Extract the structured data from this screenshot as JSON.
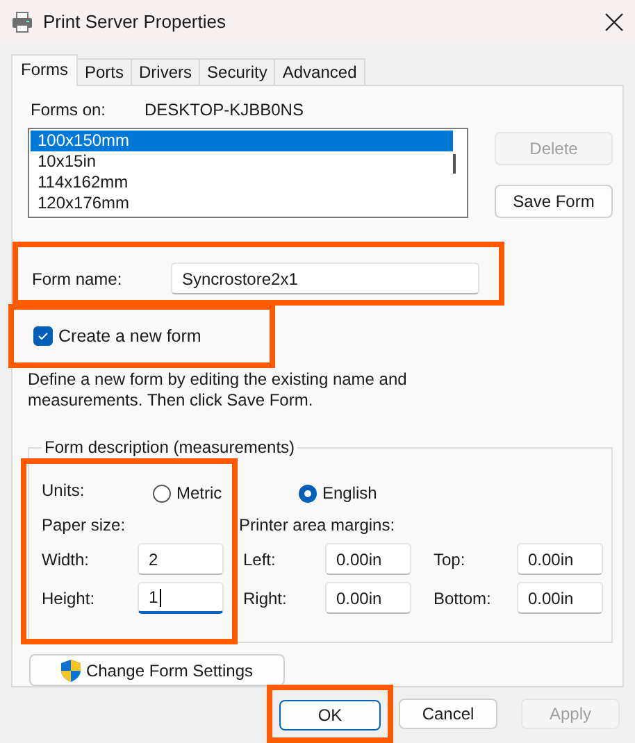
{
  "window": {
    "title": "Print Server Properties"
  },
  "tabs": [
    {
      "label": "Forms",
      "selected": true
    },
    {
      "label": "Ports",
      "selected": false
    },
    {
      "label": "Drivers",
      "selected": false
    },
    {
      "label": "Security",
      "selected": false
    },
    {
      "label": "Advanced",
      "selected": false
    }
  ],
  "forms_on": {
    "label": "Forms on:",
    "value": "DESKTOP-KJBB0NS"
  },
  "forms_list": [
    {
      "label": "100x150mm",
      "selected": true
    },
    {
      "label": "10x15in",
      "selected": false
    },
    {
      "label": "114x162mm",
      "selected": false
    },
    {
      "label": "120x176mm",
      "selected": false
    }
  ],
  "side_buttons": [
    {
      "label": "Delete",
      "disabled": true
    },
    {
      "label": "Save Form",
      "disabled": false
    }
  ],
  "form_name": {
    "label": "Form name:",
    "value": "Syncrostore2x1",
    "highlighted": true
  },
  "create_new_form": {
    "label": "Create a new form",
    "checked": true,
    "highlighted": true
  },
  "instructions": "Define a new form by editing the existing name and measurements. Then click Save Form.",
  "form_description": {
    "title": "Form description (measurements)",
    "highlighted": true,
    "units_label": "Units:",
    "units": [
      {
        "label": "Metric",
        "selected": false
      },
      {
        "label": "English",
        "selected": true
      }
    ],
    "paper_size_label": "Paper size:",
    "margins_label": "Printer area margins:",
    "paper_size": [
      {
        "label": "Width:",
        "value": "2",
        "focused": false
      },
      {
        "label": "Height:",
        "value": "1",
        "focused": true
      }
    ],
    "margins": [
      {
        "label": "Left:",
        "value": "0.00in"
      },
      {
        "label": "Top:",
        "value": "0.00in"
      },
      {
        "label": "Right:",
        "value": "0.00in"
      },
      {
        "label": "Bottom:",
        "value": "0.00in"
      }
    ]
  },
  "change_settings_button": "Change Form Settings",
  "buttons": [
    {
      "label": "OK",
      "default": true,
      "disabled": false,
      "highlighted": true
    },
    {
      "label": "Cancel",
      "default": false,
      "disabled": false,
      "highlighted": false
    },
    {
      "label": "Apply",
      "default": false,
      "disabled": true,
      "highlighted": false
    }
  ]
}
